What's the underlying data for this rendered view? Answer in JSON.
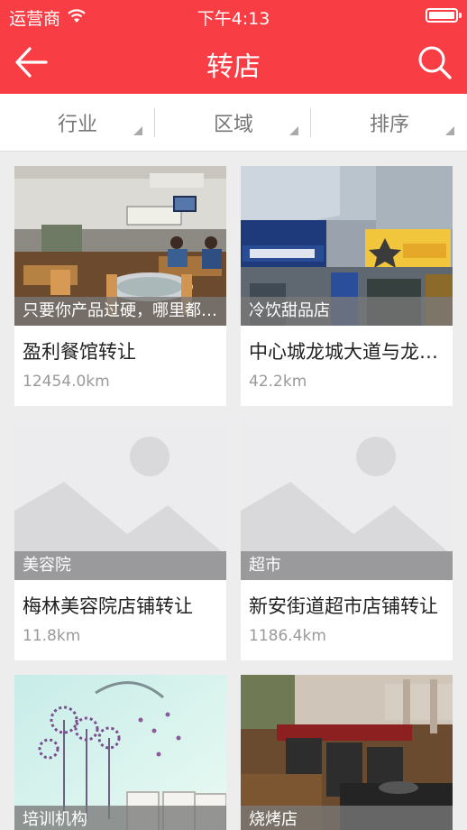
{
  "status_bar": {
    "carrier": "运营商",
    "time": "下午4:13"
  },
  "nav": {
    "title": "转店"
  },
  "filters": [
    {
      "label": "行业"
    },
    {
      "label": "区域"
    },
    {
      "label": "排序"
    }
  ],
  "listings": [
    {
      "category": "只要你产品过硬，哪里都能卖",
      "title": "盈利餐馆转让",
      "distance": "12454.0km",
      "image": "restaurant-photo"
    },
    {
      "category": "冷饮甜品店",
      "title": "中心城龙城大道与龙华路交汇处旺铺转让",
      "distance": "42.2km",
      "image": "mall-storefront-photo"
    },
    {
      "category": "美容院",
      "title": "梅林美容院店铺转让",
      "distance": "11.8km",
      "image": "placeholder-image"
    },
    {
      "category": "超市",
      "title": "新安街道超市店铺转让",
      "distance": "1186.4km",
      "image": "placeholder-image"
    },
    {
      "category": "培训机构",
      "title": "",
      "distance": "",
      "image": "classroom-wall-photo"
    },
    {
      "category": "烧烤店",
      "title": "",
      "distance": "",
      "image": "bbq-restaurant-photo"
    }
  ],
  "colors": {
    "brand": "#f93d45",
    "background": "#ededed",
    "placeholder": "#d9d9dc"
  }
}
